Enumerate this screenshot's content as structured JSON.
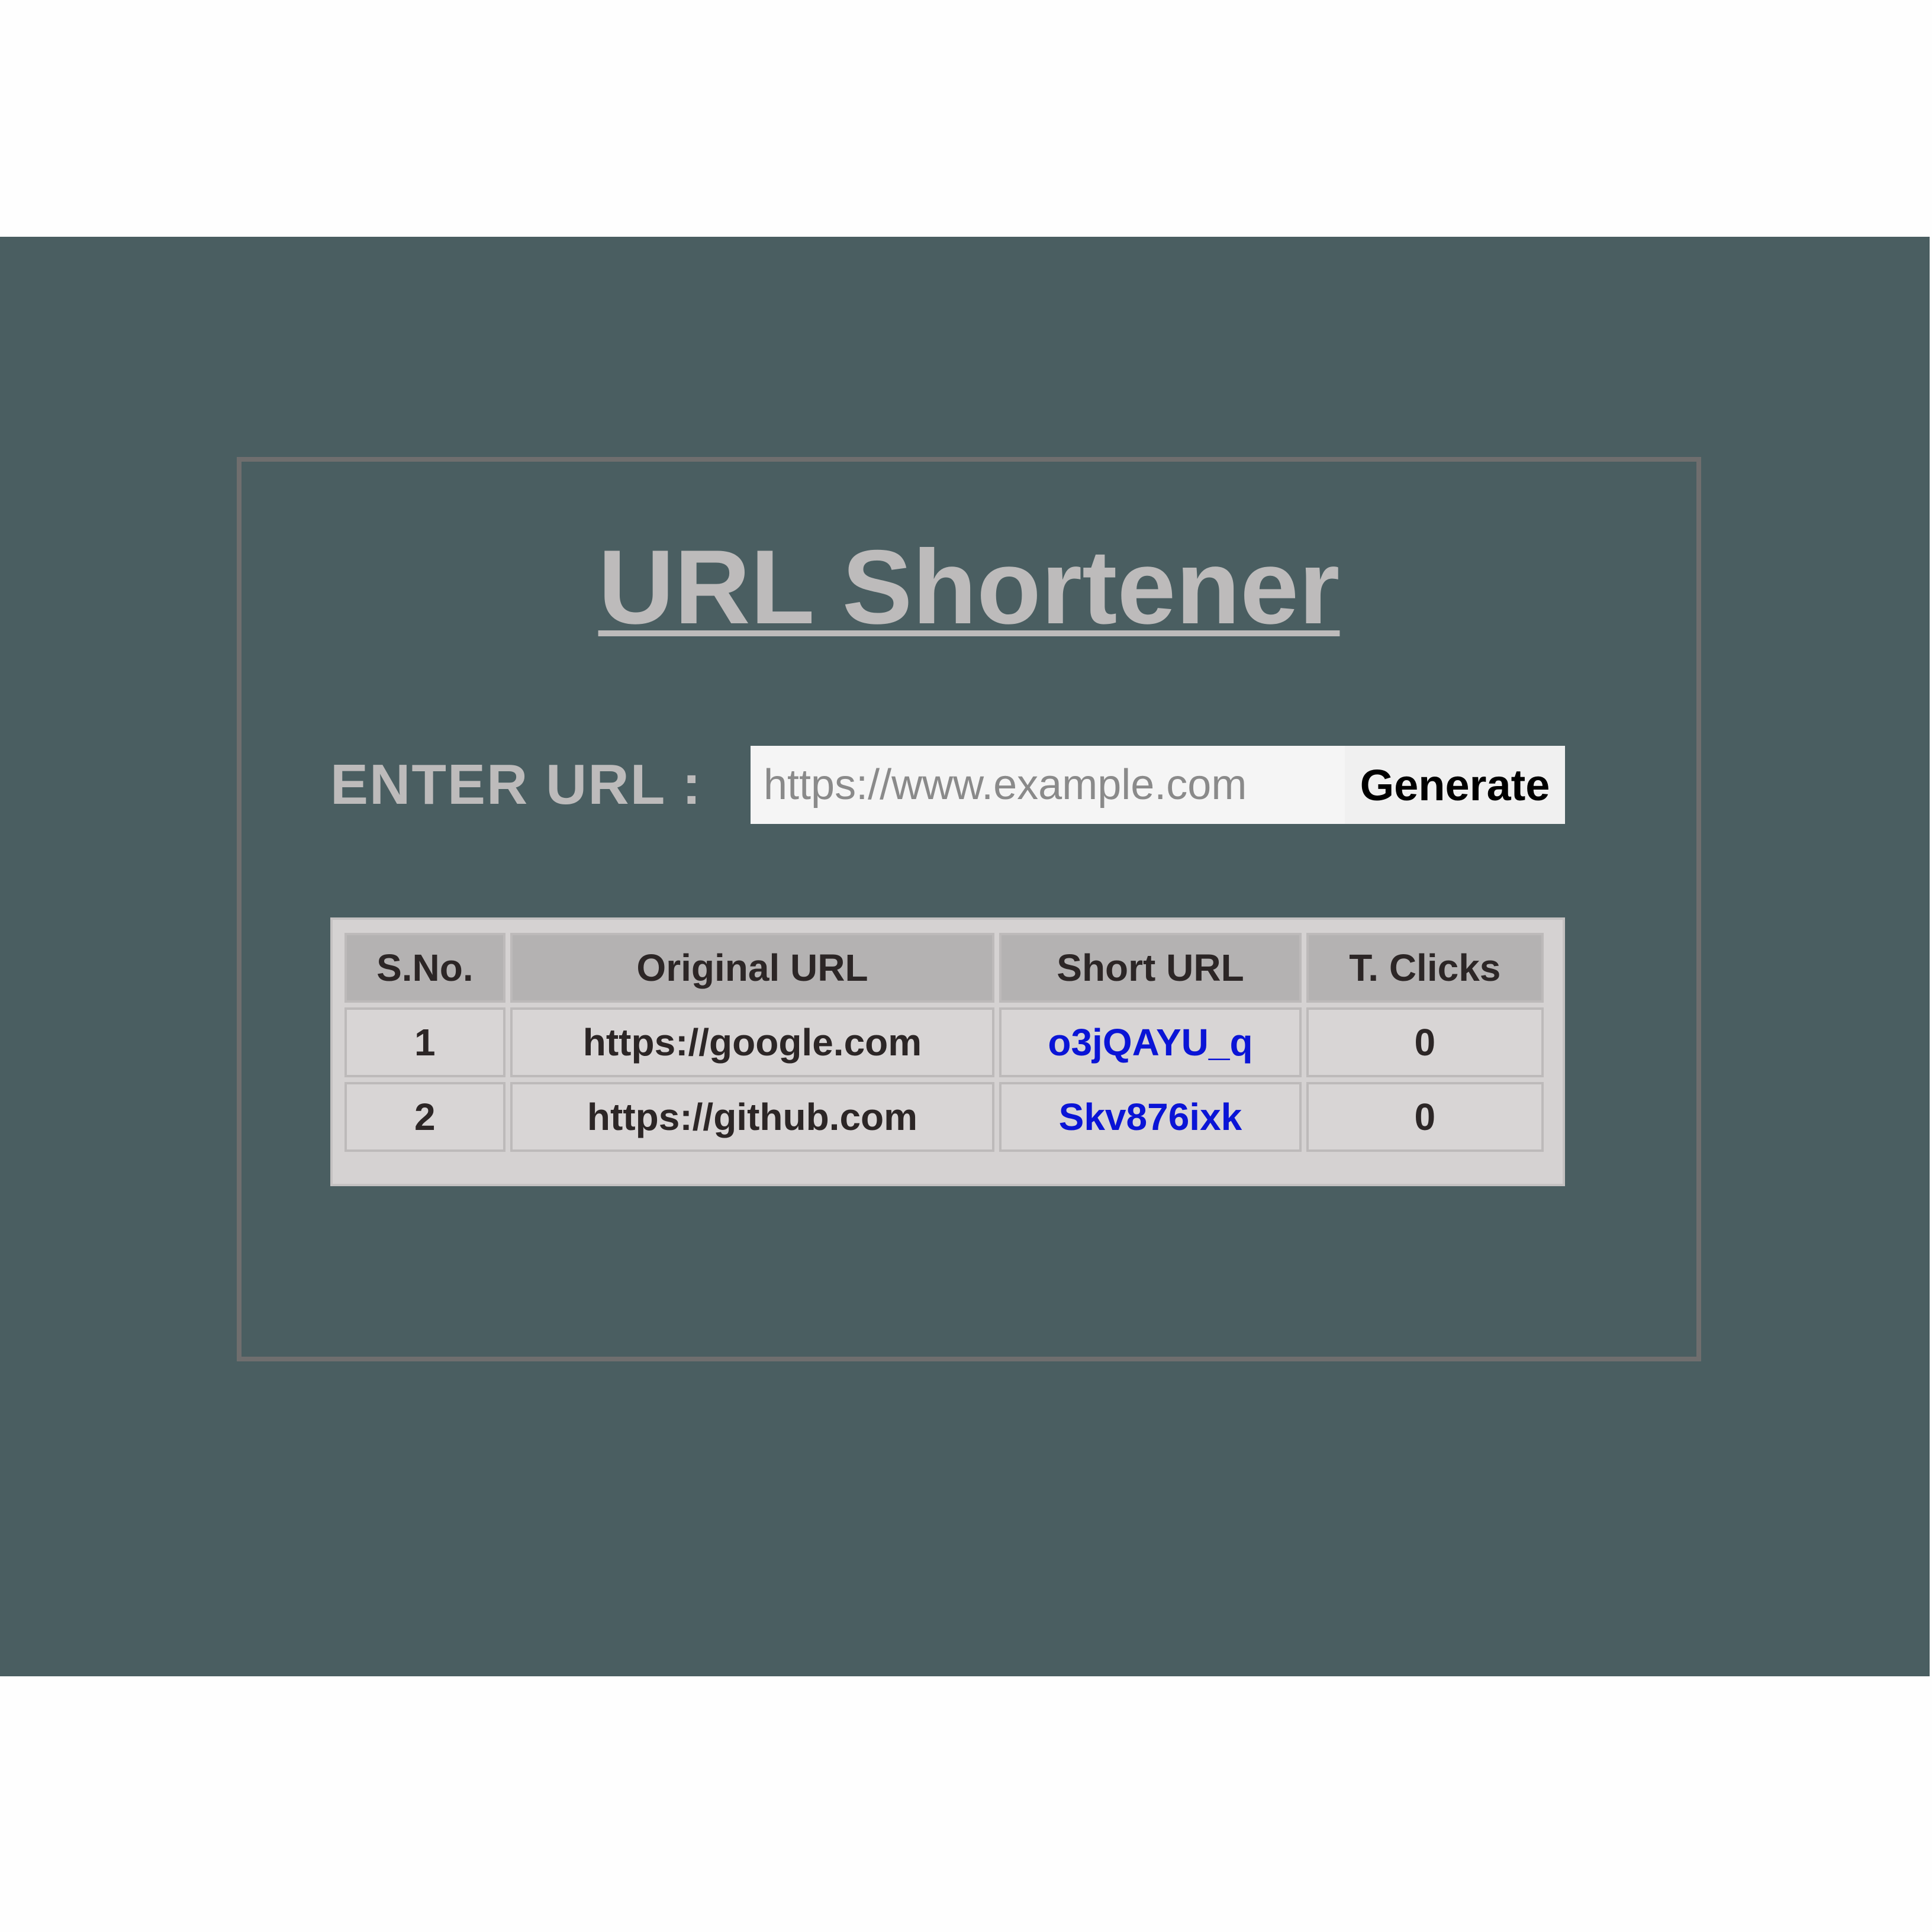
{
  "app": {
    "title": "URL Shortener"
  },
  "form": {
    "label": "ENTER URL :",
    "input_value": "",
    "input_placeholder": "https://www.example.com",
    "generate_label": "Generate"
  },
  "table": {
    "headers": [
      "S.No.",
      "Original URL",
      "Short URL",
      "T. Clicks"
    ],
    "rows": [
      {
        "sno": "1",
        "original": "https://google.com",
        "short": "o3jQAYU_q",
        "clicks": "0"
      },
      {
        "sno": "2",
        "original": "https://github.com",
        "short": "Skv876ixk",
        "clicks": "0"
      }
    ]
  },
  "colors": {
    "page_bg": "#4a5e61",
    "panel_border": "#6f6e6e",
    "title": "#bdbbbb",
    "link": "#0a14d6",
    "header_cell": "#b4b2b2",
    "body_cell": "#d8d5d5"
  }
}
